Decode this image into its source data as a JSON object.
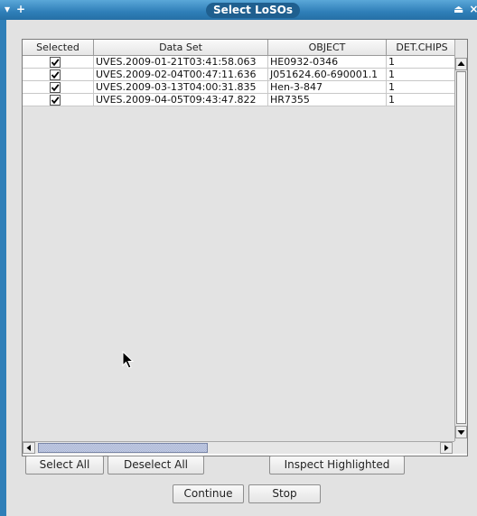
{
  "window": {
    "title": "Select LoSOs",
    "left_controls": [
      "▾",
      "+"
    ],
    "right_controls": [
      "⏏",
      "×"
    ]
  },
  "table": {
    "columns": [
      "Selected",
      "Data Set",
      "OBJECT",
      "DET.CHIPS"
    ],
    "rows": [
      {
        "selected": true,
        "dataset": "UVES.2009-01-21T03:41:58.063",
        "object": "HE0932-0346",
        "chips": "1"
      },
      {
        "selected": true,
        "dataset": "UVES.2009-02-04T00:47:11.636",
        "object": "J051624.60-690001.1",
        "chips": "1"
      },
      {
        "selected": true,
        "dataset": "UVES.2009-03-13T04:00:31.835",
        "object": "Hen-3-847",
        "chips": "1"
      },
      {
        "selected": true,
        "dataset": "UVES.2009-04-05T09:43:47.822",
        "object": "HR7355",
        "chips": "1"
      }
    ]
  },
  "buttons": {
    "select_all": "Select All",
    "deselect_all": "Deselect All",
    "inspect_highlighted": "Inspect Highlighted",
    "continue": "Continue",
    "stop": "Stop"
  },
  "icons": {
    "menu": "chevron-down-icon",
    "add": "plus-icon",
    "eject": "eject-icon",
    "close": "close-icon",
    "checkbox": "checkbox-checked-icon",
    "cursor": "mouse-pointer-icon"
  }
}
